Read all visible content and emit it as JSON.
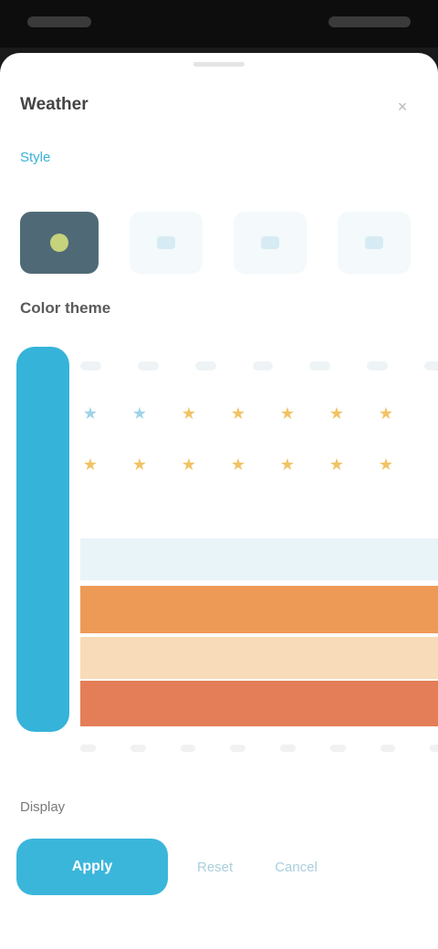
{
  "sheet": {
    "title": "Weather",
    "close_label": "×"
  },
  "top_link": "Style",
  "section": {
    "title": "Color theme"
  },
  "style_thumbs": [
    "active",
    "plain",
    "plain",
    "plain",
    "plain"
  ],
  "pattern": {
    "stars": [
      "★",
      "★",
      "★",
      "★",
      "★",
      "★",
      "★",
      "★"
    ]
  },
  "bottom": {
    "label": "Display",
    "primary_button": "Apply",
    "secondary_button_1": "Reset",
    "secondary_button_2": "Cancel"
  },
  "colors": {
    "accent": "#35b3d9",
    "orange": "#ee9a57",
    "peach": "#f8dbb8",
    "red_orange": "#e37e58"
  }
}
